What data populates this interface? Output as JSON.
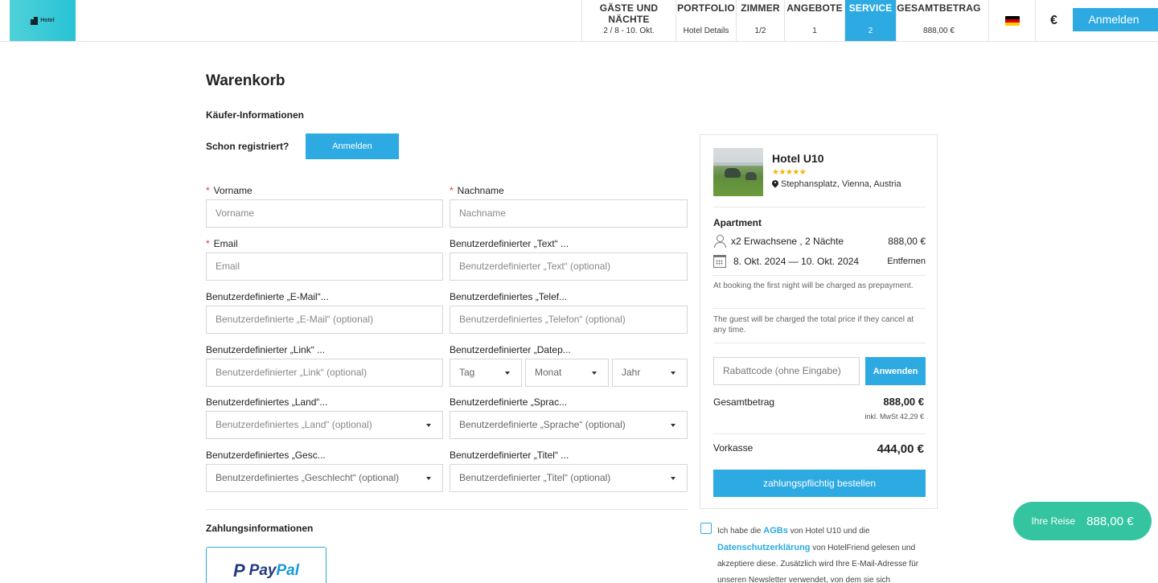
{
  "header": {
    "logo_text": "Hotel",
    "steps": [
      {
        "title": "GÄSTE UND\nNÄCHTE",
        "value": "2 / 8 - 10. Okt."
      },
      {
        "title": "PORTFOLIO",
        "value": "Hotel Details"
      },
      {
        "title": "ZIMMER",
        "value": "1/2"
      },
      {
        "title": "ANGEBOTE",
        "value": "1"
      },
      {
        "title": "SERVICE",
        "value": "2"
      },
      {
        "title": "GESAMTBETRAG",
        "value": "888,00 €"
      }
    ],
    "active_step": "SERVICE",
    "language_flag_icon": "german-flag-icon",
    "currency": "€",
    "login_label": "Anmelden"
  },
  "page": {
    "title": "Warenkorb",
    "buyer_section": "Käufer-Informationen",
    "already_registered": "Schon registriert?",
    "login_label": "Anmelden"
  },
  "form": {
    "firstname": {
      "label": "Vorname",
      "placeholder": "Vorname"
    },
    "lastname": {
      "label": "Nachname",
      "placeholder": "Nachname"
    },
    "email": {
      "label": "Email",
      "placeholder": "Email"
    },
    "custom_text": {
      "label": "Benutzerdefinierter „Text“ ...",
      "placeholder": "Benutzerdefinierter „Text“ (optional)"
    },
    "custom_email": {
      "label": "Benutzerdefinierte „E-Mail“...",
      "placeholder": "Benutzerdefinierte „E-Mail“ (optional)"
    },
    "custom_phone": {
      "label": "Benutzerdefiniertes „Telef...",
      "placeholder": "Benutzerdefiniertes „Telefon“ (optional)"
    },
    "custom_link": {
      "label": "Benutzerdefinierter „Link“ ...",
      "placeholder": "Benutzerdefinierter „Link“ (optional)"
    },
    "custom_date": {
      "label": "Benutzerdefinierter „Datep...",
      "day": "Tag",
      "month": "Monat",
      "year": "Jahr"
    },
    "custom_country": {
      "label": "Benutzerdefiniertes „Land“...",
      "placeholder": "Benutzerdefiniertes „Land“ (optional)"
    },
    "custom_language": {
      "label": "Benutzerdefinierte „Sprac...",
      "placeholder": "Benutzerdefinierte „Sprache“ (optional)"
    },
    "custom_gender": {
      "label": "Benutzerdefiniertes „Gesc...",
      "placeholder": "Benutzerdefiniertes „Geschlecht“ (optional)"
    },
    "custom_title": {
      "label": "Benutzerdefinierter „Titel“ ...",
      "placeholder": "Benutzerdefinierter „Titel“ (optional)"
    },
    "required_mark": "*"
  },
  "payment": {
    "title": "Zahlungsinformationen",
    "paypal_mark": "P",
    "paypal_text_1": "Pay",
    "paypal_text_2": "Pal"
  },
  "summary": {
    "hotel_name": "Hotel U10",
    "stars": "★★★★★",
    "address": "Stephansplatz, Vienna, Austria",
    "room_type": "Apartment",
    "guests": "x2 Erwachsene , 2 Nächte",
    "room_price": "888,00 €",
    "dates": "8. Okt. 2024 — 10. Okt. 2024",
    "remove_label": "Entfernen",
    "note_1": "At booking the first night will be charged as prepayment.",
    "note_2": "The guest will be charged the total price if they cancel at any time.",
    "coupon_placeholder": "Rabattcode (ohne Eingabe)",
    "apply_label": "Anwenden",
    "total_label": "Gesamtbetrag",
    "total_value": "888,00 €",
    "vat": "inkl. MwSt 42,29 €",
    "prepay_label": "Vorkasse",
    "prepay_value": "444,00 €",
    "order_label": "zahlungspflichtig bestellen"
  },
  "terms": {
    "part1": "Ich habe die ",
    "agb": "AGBs",
    "part2": " von Hotel U10 und die ",
    "privacy": "Datenschutzerklärung",
    "part3": " von HotelFriend gelesen und akzeptiere diese. Zusätzlich wird Ihre E-Mail-Adresse für unseren Newsletter verwendet, von dem sie sich"
  },
  "trip": {
    "label": "Ihre Reise",
    "value": "888,00 €"
  },
  "colors": {
    "accent": "#2daae2",
    "trip_pill": "#35c4a0",
    "required": "#e53935",
    "stars": "#f5b301"
  }
}
